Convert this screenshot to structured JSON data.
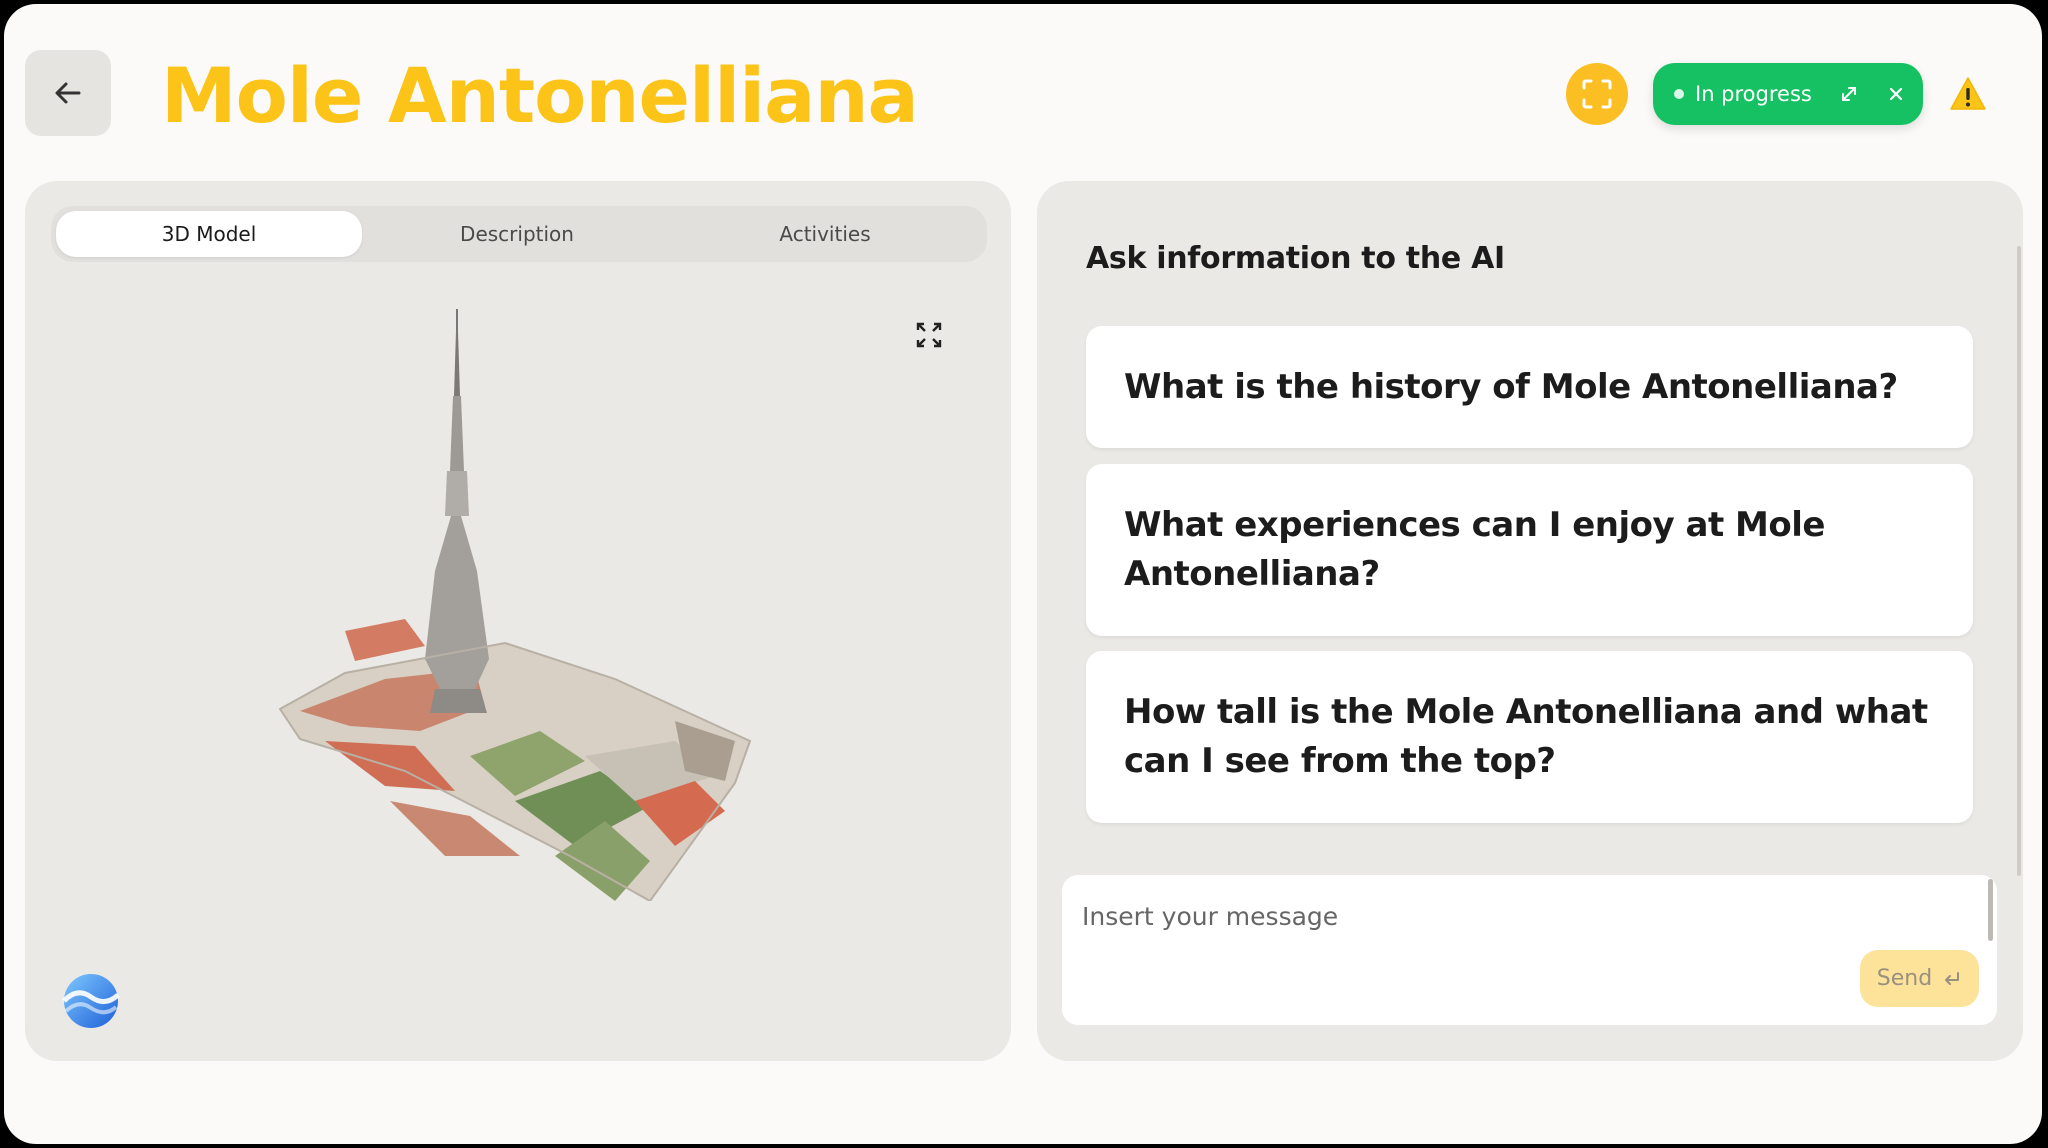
{
  "header": {
    "title": "Mole Antonelliana",
    "status_label": "In progress"
  },
  "tabs": [
    {
      "label": "3D Model",
      "active": true
    },
    {
      "label": "Description",
      "active": false
    },
    {
      "label": "Activities",
      "active": false
    }
  ],
  "ai": {
    "heading": "Ask information to the AI",
    "questions": [
      "What is the history of Mole Antonelliana?",
      "What experiences can I enjoy at Mole Antonelliana?",
      "How tall is the Mole Antonelliana and what can I see from the top?"
    ],
    "input_placeholder": "Insert your message",
    "send_label": "Send"
  },
  "colors": {
    "title": "#fcc419",
    "status_green": "#16c163",
    "scan_yellow": "#fbbf24",
    "send_bg": "#fde39a"
  },
  "icons": [
    "arrow-left-icon",
    "scan-icon",
    "expand-icon",
    "close-icon",
    "warning-icon",
    "fullscreen-icon",
    "enter-icon",
    "ai-logo-icon"
  ]
}
